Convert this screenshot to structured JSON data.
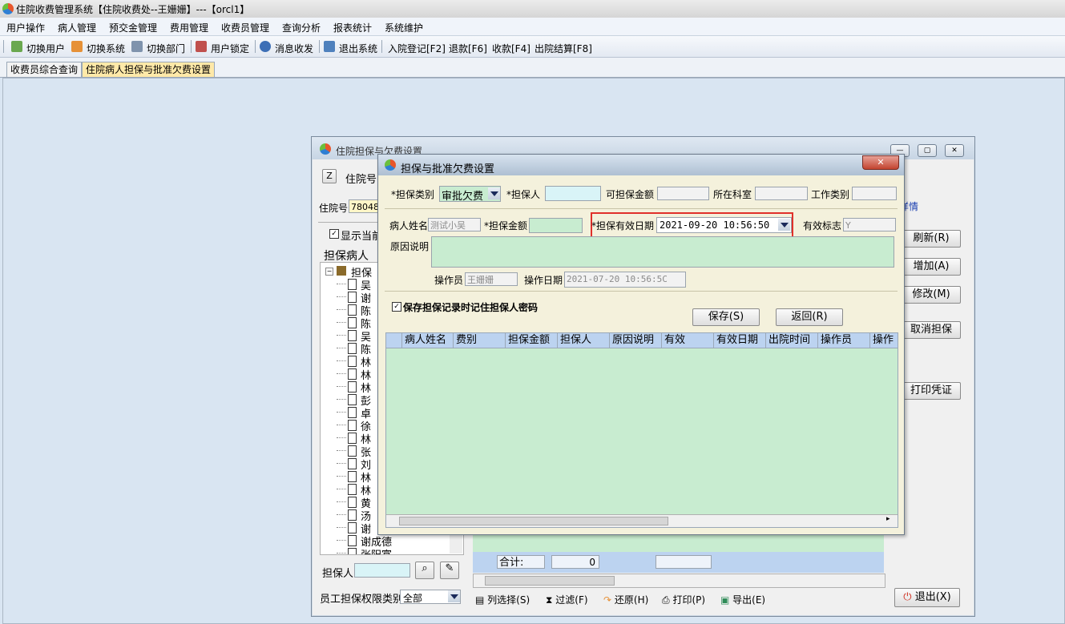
{
  "app_title": "住院收费管理系统【住院收费处--王姗姗】---【orcl1】",
  "menu": [
    "用户操作",
    "病人管理",
    "预交金管理",
    "费用管理",
    "收费员管理",
    "查询分析",
    "报表统计",
    "系统维护"
  ],
  "toolbar": [
    "切换用户",
    "切换系统",
    "切换部门",
    "用户锁定",
    "消息收发",
    "退出系统",
    "入院登记[F2]",
    "退款[F6]",
    "收款[F4]",
    "出院结算[F8]"
  ],
  "tabs": [
    "收费员综合查询",
    "住院病人担保与批准欠费设置"
  ],
  "outer_window": {
    "title": "住院担保与欠费设置",
    "key_button": "Z",
    "inpatient_label": "住院号",
    "inpatient_label2": "住院号",
    "inpatient_value": "780485",
    "show_current": "显示当前",
    "guarantee_patient": "担保病人",
    "tree_root": "担保",
    "tree_items": [
      "吴",
      "谢",
      "陈",
      "陈",
      "吴",
      "陈",
      "林",
      "林",
      "林",
      "彭",
      "卓",
      "徐",
      "林",
      "张",
      "刘",
      "林",
      "林",
      "黄",
      "汤",
      "谢",
      "谢成德",
      "张阳富"
    ],
    "detail_link": "详情",
    "refresh": "刷新(R)",
    "add": "增加(A)",
    "modify": "修改(M)",
    "cancel_guarantee": "取消担保",
    "print_voucher": "打印凭证",
    "exit": "退出(X)",
    "guarantor_label": "担保人",
    "perm_label": "员工担保权限类别",
    "perm_value": "全部",
    "total_label": "合计:",
    "total_value": "0",
    "bottom_tools": [
      "列选择(S)",
      "过滤(F)",
      "还原(H)",
      "打印(P)",
      "导出(E)"
    ]
  },
  "modal": {
    "title": "担保与批准欠费设置",
    "type_label": "*担保类别",
    "type_value": "审批欠费",
    "guarantor_label": "*担保人",
    "available_label": "可担保金额",
    "dept_label": "所在科室",
    "job_label": "工作类别",
    "patient_label": "病人姓名",
    "patient_value": "测试小吴",
    "amount_label": "*担保金额",
    "valid_date_label": "*担保有效日期",
    "valid_date_value": "2021-09-20 10:56:50",
    "valid_flag_label": "有效标志",
    "valid_flag_value": "Y",
    "reason_label": "原因说明",
    "operator_label": "操作员",
    "operator_value": "王姗姗",
    "op_date_label": "操作日期",
    "op_date_value": "2021-07-20 10:56:5C",
    "save_pwd": "保存担保记录时记住担保人密码",
    "save_btn": "保存(S)",
    "back_btn": "返回(R)",
    "columns": [
      "病人姓名",
      "费别",
      "担保金额",
      "担保人",
      "原因说明",
      "有效",
      "有效日期",
      "出院时间",
      "操作员",
      "操作"
    ]
  },
  "colors": {
    "highlight_border": "#e0302a",
    "grid_bg": "#c8ecd0",
    "header_bg": "#bcd3f0",
    "tab_active": "#ffe9a8"
  }
}
